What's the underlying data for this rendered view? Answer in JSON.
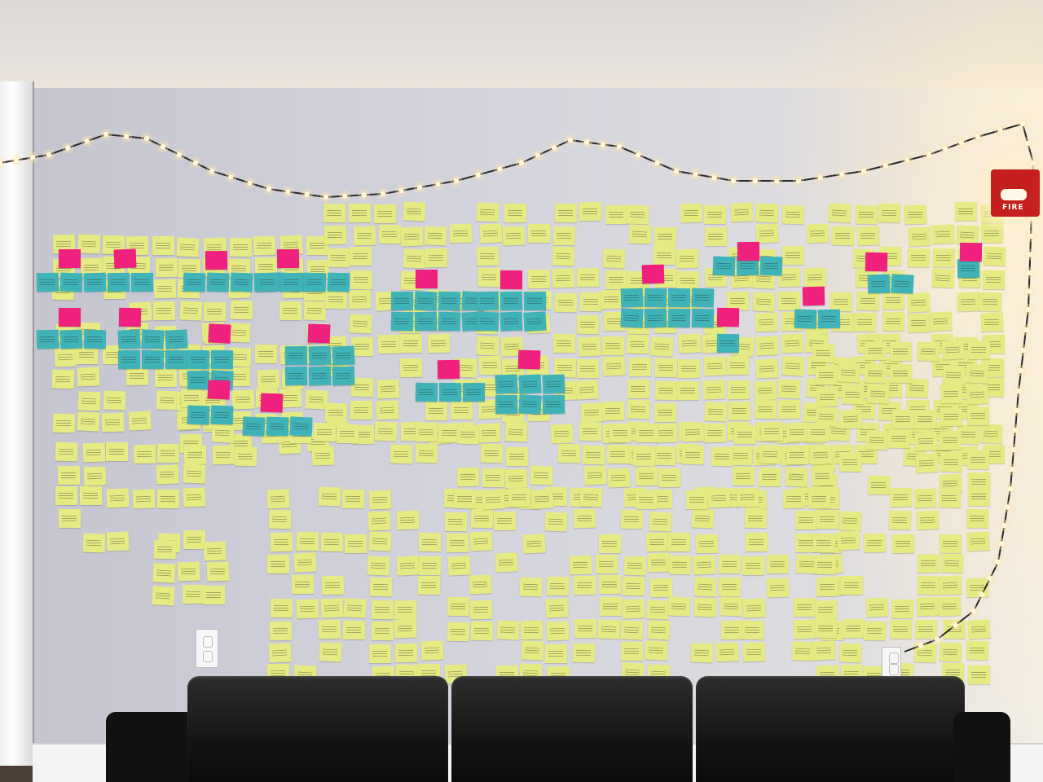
{
  "scene": {
    "description_label": "",
    "fire_alarm": {
      "label": "FIRE"
    }
  },
  "colors": {
    "yellow_note": "#e6ea82",
    "blue_note": "#3fb3b7",
    "pink_note": "#f0207e",
    "wall": "#d3d3dc",
    "sofa": "#151515",
    "light_bulb": "#fff6d8"
  }
}
